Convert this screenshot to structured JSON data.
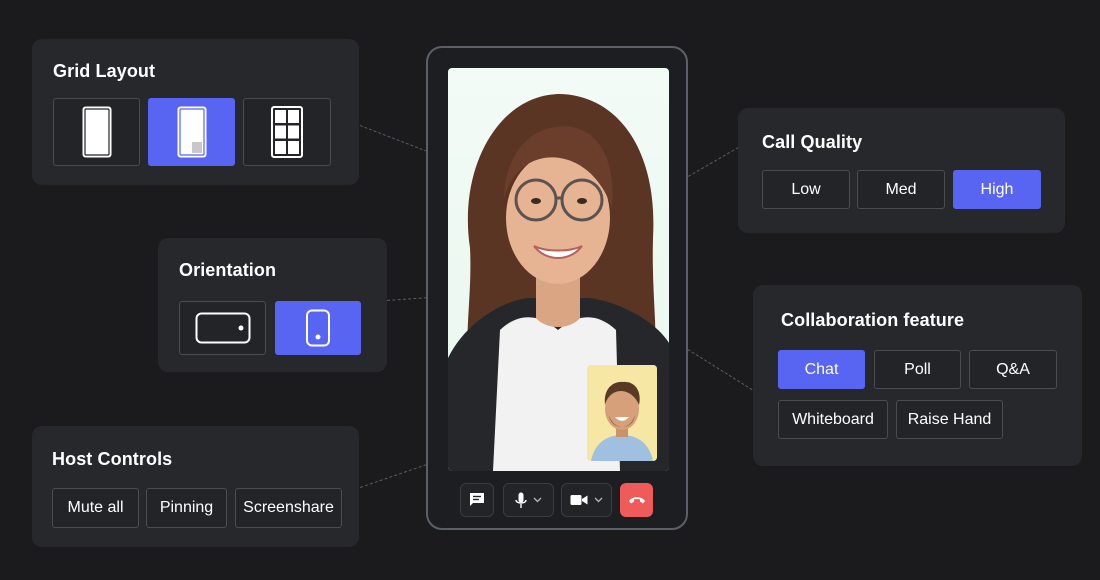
{
  "grid_layout": {
    "title": "Grid Layout",
    "options": [
      {
        "icon": "single-view-icon",
        "active": false
      },
      {
        "icon": "spotlight-view-icon",
        "active": true
      },
      {
        "icon": "grid-view-icon",
        "active": false
      }
    ]
  },
  "orientation": {
    "title": "Orientation",
    "options": [
      {
        "icon": "landscape-icon",
        "active": false
      },
      {
        "icon": "portrait-icon",
        "active": true
      }
    ]
  },
  "host_controls": {
    "title": "Host Controls",
    "buttons": [
      "Mute all",
      "Pinning",
      "Screenshare"
    ]
  },
  "call_quality": {
    "title": "Call Quality",
    "options": [
      "Low",
      "Med",
      "High"
    ],
    "selected": "High"
  },
  "collaboration": {
    "title": "Collaboration feature",
    "options": [
      "Chat",
      "Poll",
      "Q&A",
      "Whiteboard",
      "Raise Hand"
    ],
    "selected": "Chat"
  },
  "call_controls": {
    "icons": [
      "chat-icon",
      "microphone-icon",
      "camera-icon",
      "end-call-icon"
    ]
  },
  "colors": {
    "accent": "#5865f2",
    "end_call": "#ef5a5a",
    "panel": "#27282c",
    "background": "#1b1b1d"
  }
}
